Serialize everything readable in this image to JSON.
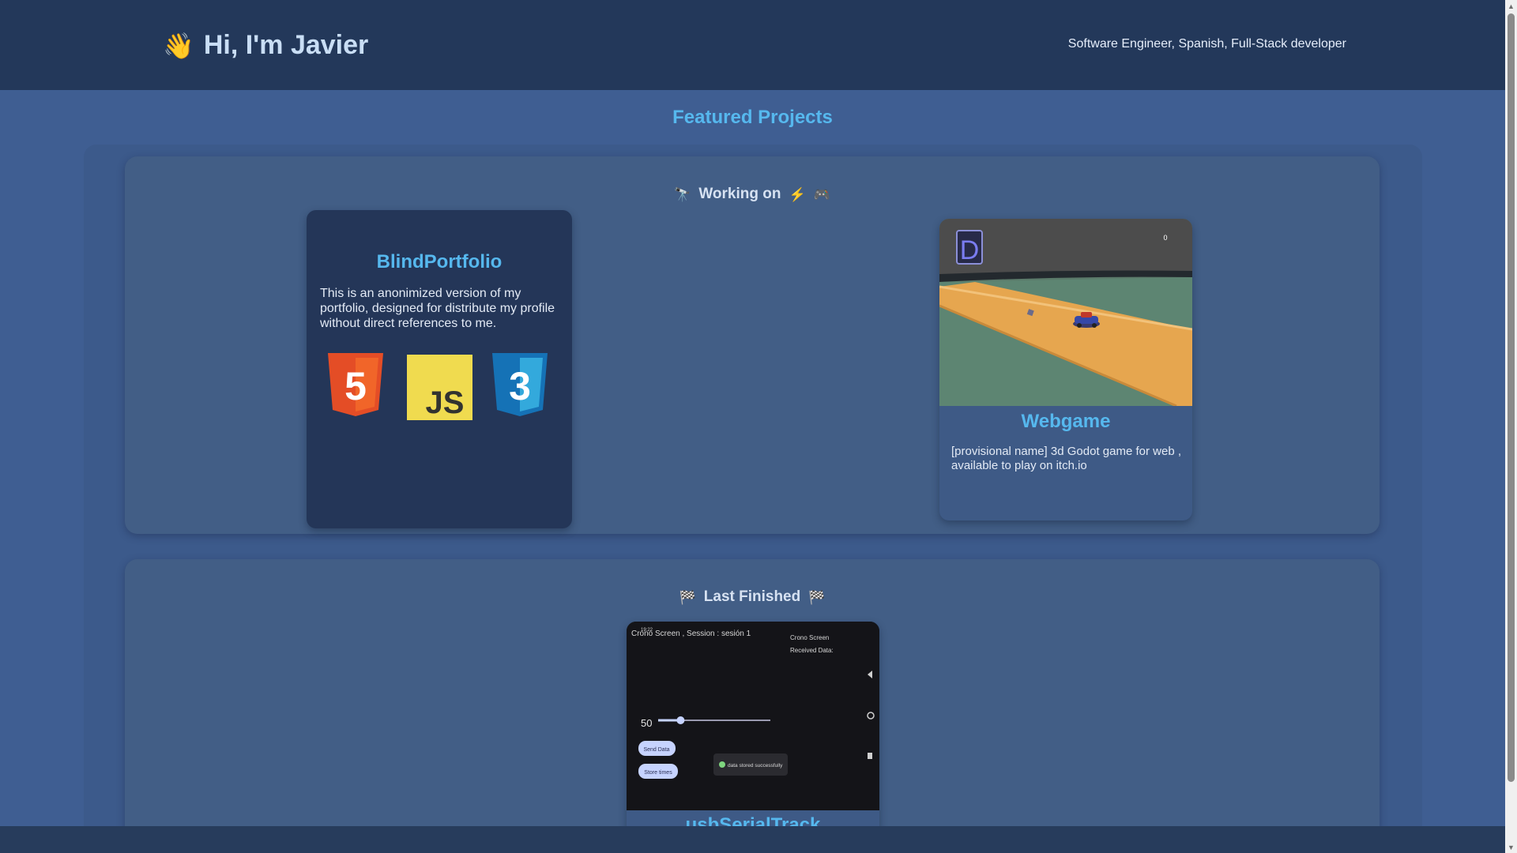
{
  "header": {
    "greeting_icon": "waving-hand-icon",
    "greeting_emoji": "👋",
    "title": "Hi, I'm Javier",
    "subtitle": "Software Engineer, Spanish, Full-Stack developer"
  },
  "featured": {
    "title": "Featured Projects"
  },
  "working_on": {
    "heading": "Working on",
    "icons": [
      "telescope-icon",
      "lightning-icon",
      "game-controller-icon"
    ],
    "emoji_left": "🔭",
    "emoji_right_1": "⚡",
    "emoji_right_2": "🎮",
    "projects": [
      {
        "title": "BlindPortfolio",
        "description": "This is an anonimized version of my portfolio, designed for distribute my profile without direct references to me.",
        "tech_icons": [
          "html5-icon",
          "javascript-icon",
          "css3-icon"
        ],
        "tech_labels": {
          "html": "5",
          "js": "JS",
          "css": "3"
        }
      },
      {
        "title": "Webgame",
        "description": "[provisional name] 3d Godot game for web , available to play on itch.io",
        "screenshot_letter": "D",
        "screenshot_counter": "0"
      }
    ]
  },
  "last_finished": {
    "heading": "Last Finished",
    "emoji": "🏁",
    "icons": [
      "checkered-flag-icon",
      "checkered-flag-icon"
    ],
    "projects": [
      {
        "title": "usbSerialTrack",
        "screenshot": {
          "status_time": "19:22",
          "header": "Crono Screen , Session : sesión 1",
          "side_title": "Crono Screen",
          "side_subtitle": "Received Data:",
          "slider_value": "50",
          "slider_level": 0.2,
          "button_send": "Send Data",
          "button_store": "Store times",
          "toast": "data stored successfully"
        }
      }
    ]
  },
  "colors": {
    "header_bg": "#23385a",
    "page_bg": "#3f5e92",
    "accent": "#56b8ee"
  }
}
